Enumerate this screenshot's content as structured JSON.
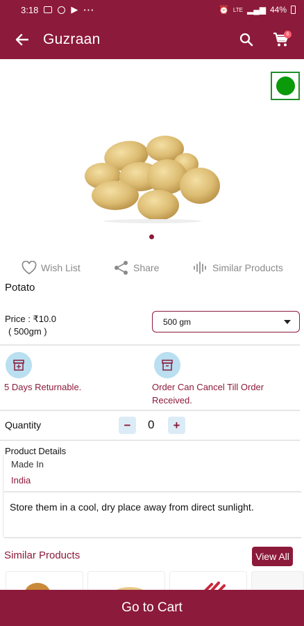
{
  "status_bar": {
    "time": "3:18",
    "overflow": "···",
    "network": "LTE",
    "battery": "44%"
  },
  "app_bar": {
    "title": "Guzraan",
    "cart_count": "6"
  },
  "colors": {
    "primary": "#8c1a3a",
    "veg_indicator": "#0a9a0a",
    "policy_icon_bg": "#b9dff0"
  },
  "actions": {
    "wishlist": "Wish List",
    "share": "Share",
    "similar": "Similar Products"
  },
  "product": {
    "name": "Potato",
    "price": "Price : ₹10.0",
    "unit": "( 500gm )",
    "selected_weight": "500 gm"
  },
  "policies": {
    "returnable": "5 Days Returnable.",
    "cancel_line1": "Order Can Cancel Till Order",
    "cancel_line2": "Received."
  },
  "quantity": {
    "label": "Quantity",
    "value": "0",
    "minus": "−",
    "plus": "+"
  },
  "details": {
    "heading": "Product Details",
    "made_in_label": "Made In",
    "made_in_value": "India",
    "description": "Store them in a cool, dry place away from direct sunlight."
  },
  "similar": {
    "title": "Similar Products",
    "view_all": "View All"
  },
  "footer": {
    "go_to_cart": "Go to Cart"
  }
}
